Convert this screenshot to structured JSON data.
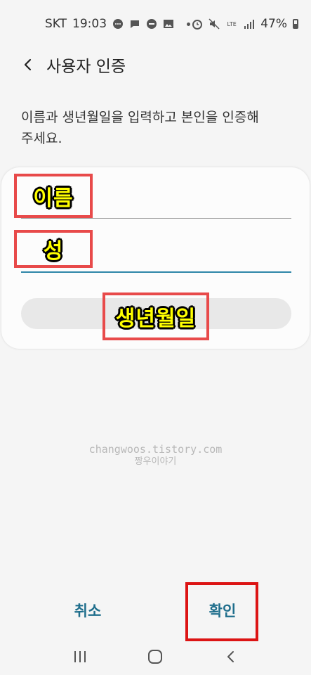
{
  "status_bar": {
    "carrier": "SKT",
    "time": "19:03",
    "network": "LTE",
    "battery": "47%",
    "battery_level": 0.47
  },
  "header": {
    "title": "사용자 인증"
  },
  "instruction": {
    "line1": "이름과 생년월일을 입력하고 본인을 인증해",
    "line2": "주세요."
  },
  "form": {
    "first_name_value": "",
    "last_name_value": ""
  },
  "annotations": {
    "name": "이름",
    "last_name": "성",
    "birthdate": "생년월일"
  },
  "watermark": {
    "line1": "changwoos.tistory.com",
    "line2": "짱우이야기"
  },
  "actions": {
    "cancel": "취소",
    "confirm": "확인"
  },
  "colors": {
    "accent": "#1f6e8c",
    "highlight_border": "#e84a4a",
    "annotation_text": "#ffff00"
  }
}
